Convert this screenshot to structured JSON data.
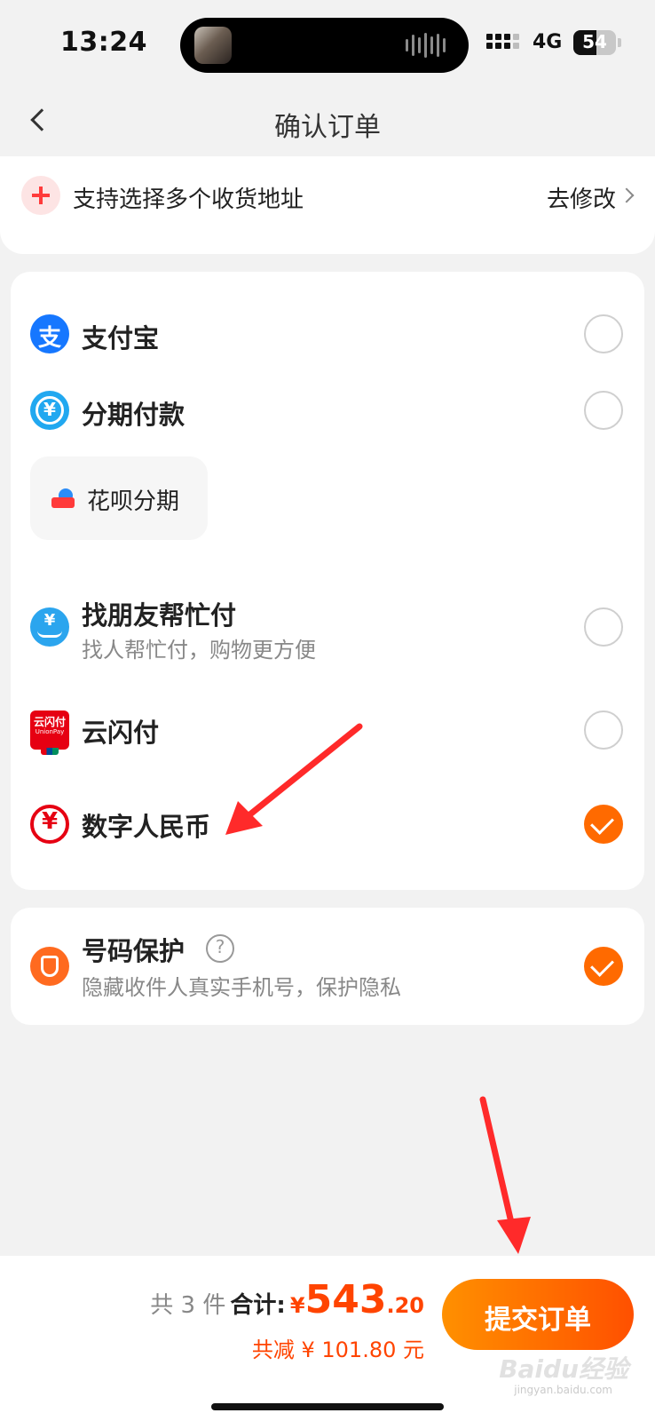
{
  "status_bar": {
    "time": "13:24",
    "network": "4G",
    "battery": "54",
    "battery_level": 0.54
  },
  "nav": {
    "title": "确认订单",
    "back_icon": "chevron-left-icon"
  },
  "address": {
    "text": "支持选择多个收货地址",
    "edit_label": "去修改"
  },
  "payment_methods": [
    {
      "label": "支付宝",
      "icon": "alipay-icon",
      "selected": false
    },
    {
      "label": "分期付款",
      "icon": "installment-icon",
      "selected": false,
      "sub_option": "花呗分期"
    },
    {
      "label": "找朋友帮忙付",
      "sublabel": "找人帮忙付，购物更方便",
      "icon": "friend-pay-icon",
      "selected": false
    },
    {
      "label": "云闪付",
      "icon": "unionpay-icon",
      "selected": false
    },
    {
      "label": "数字人民币",
      "icon": "ecny-icon",
      "selected": true
    }
  ],
  "privacy": {
    "label": "号码保护",
    "sublabel": "隐藏收件人真实手机号，保护隐私",
    "help_glyph": "?",
    "enabled": true
  },
  "summary": {
    "count_text": "共 3 件",
    "total_label": "合计:",
    "currency": "¥",
    "total_integer": "543",
    "total_decimal": ".20",
    "discount_text": "共减 ¥ 101.80 元"
  },
  "submit_label": "提交订单",
  "colors": {
    "accent": "#ff6a00",
    "price": "#ff4400",
    "annotation": "#ff2a2a"
  },
  "watermark": {
    "brand": "Baidu经验",
    "url": "jingyan.baidu.com"
  }
}
